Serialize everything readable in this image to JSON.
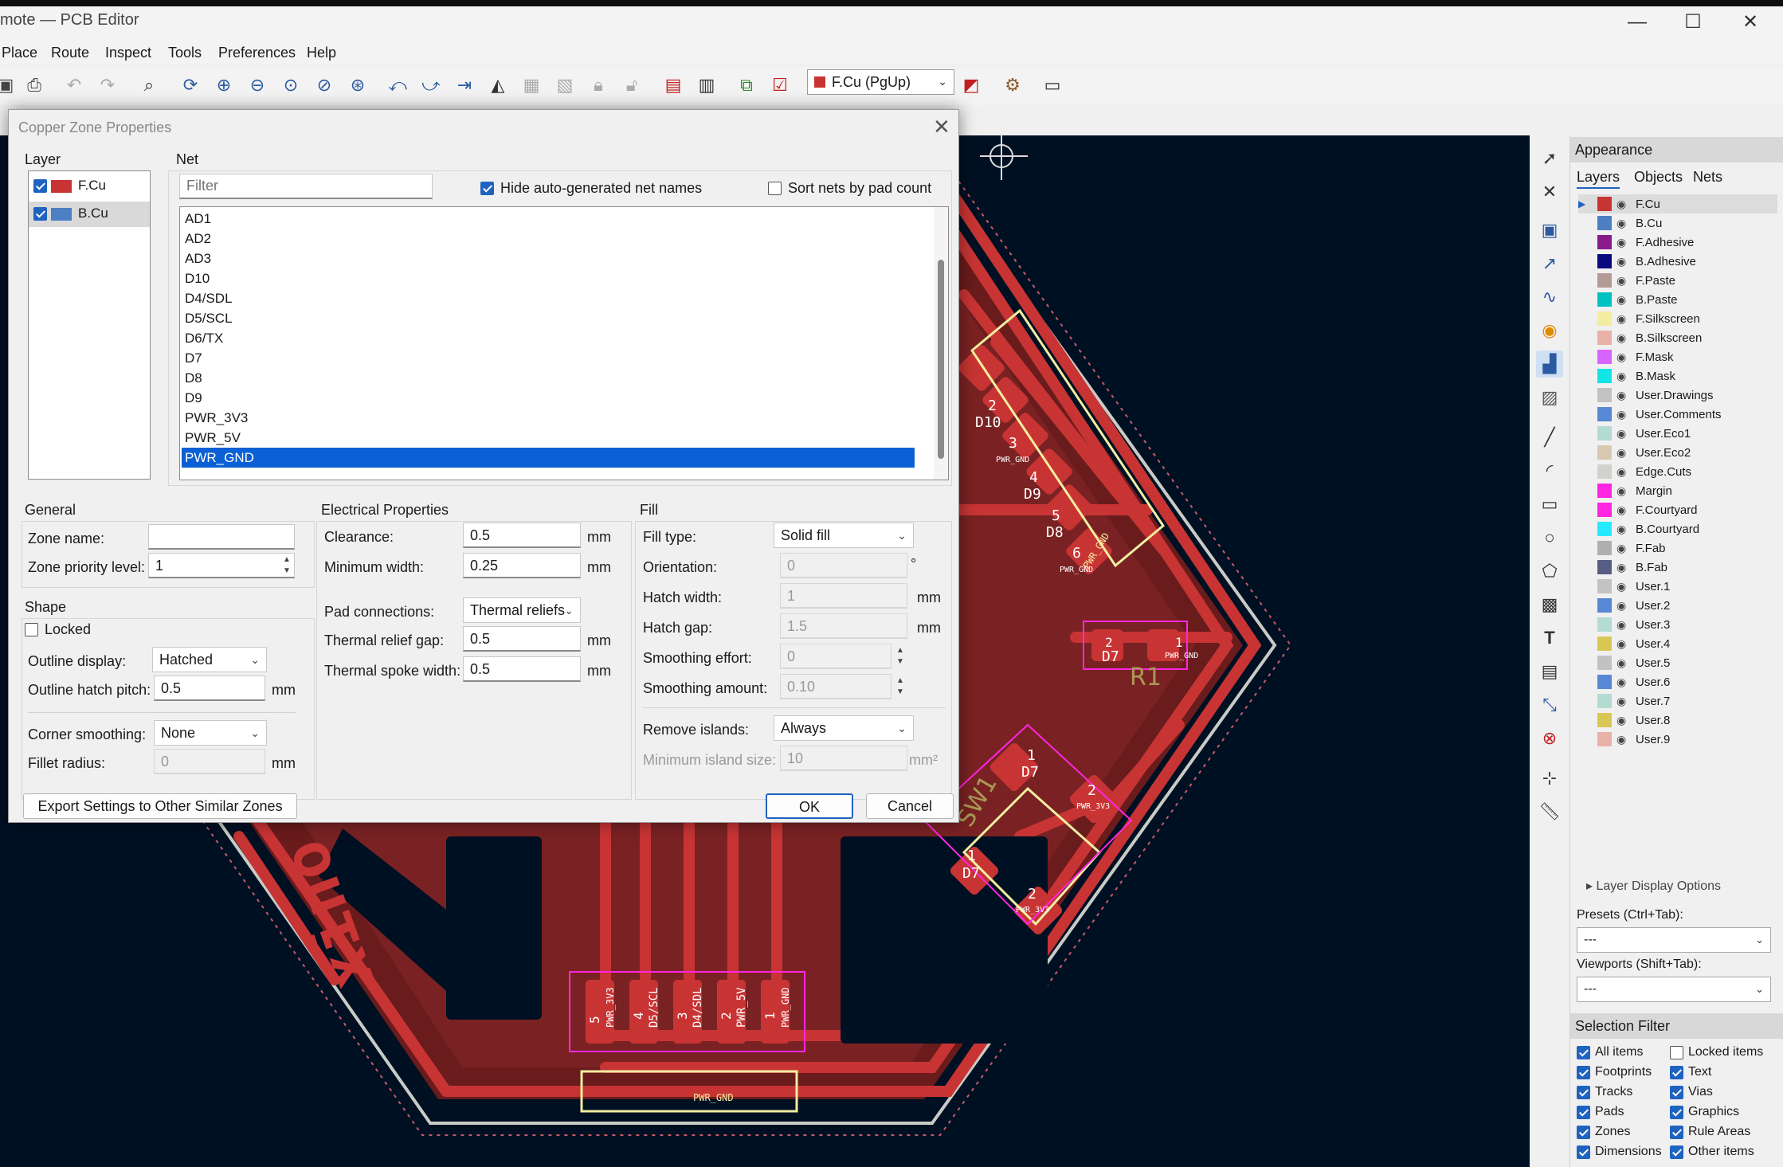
{
  "window": {
    "title": "mote — PCB Editor",
    "minimize": "—",
    "maximize": "☐",
    "close": "✕"
  },
  "menu": [
    "Place",
    "Route",
    "Inspect",
    "Tools",
    "Preferences",
    "Help"
  ],
  "toolbar": {
    "active_layer": "F.Cu (PgUp)",
    "layer_color": "#c83434"
  },
  "dialog": {
    "title": "Copper Zone Properties",
    "layer_label": "Layer",
    "layers": [
      {
        "name": "F.Cu",
        "color": "#c83434",
        "checked": true
      },
      {
        "name": "B.Cu",
        "color": "#4d7fc4",
        "checked": true
      }
    ],
    "net_label": "Net",
    "filter_placeholder": "Filter",
    "hide_auto_label": "Hide auto-generated net names",
    "sort_label": "Sort nets by pad count",
    "nets": [
      "AD1",
      "AD2",
      "AD3",
      "D10",
      "D4/SDL",
      "D5/SCL",
      "D6/TX",
      "D7",
      "D8",
      "D9",
      "PWR_3V3",
      "PWR_5V",
      "PWR_GND"
    ],
    "selected_net": "PWR_GND",
    "general": {
      "title": "General",
      "zone_name_label": "Zone name:",
      "zone_name": "",
      "priority_label": "Zone priority level:",
      "priority": "1"
    },
    "shape": {
      "title": "Shape",
      "locked_label": "Locked",
      "outline_display_label": "Outline display:",
      "outline_display": "Hatched",
      "hatch_pitch_label": "Outline hatch pitch:",
      "hatch_pitch": "0.5",
      "corner_label": "Corner smoothing:",
      "corner": "None",
      "fillet_label": "Fillet radius:",
      "fillet": "0",
      "unit": "mm"
    },
    "electrical": {
      "title": "Electrical Properties",
      "clearance_label": "Clearance:",
      "clearance": "0.5",
      "min_width_label": "Minimum width:",
      "min_width": "0.25",
      "pad_conn_label": "Pad connections:",
      "pad_conn": "Thermal reliefs",
      "relief_gap_label": "Thermal relief gap:",
      "relief_gap": "0.5",
      "spoke_label": "Thermal spoke width:",
      "spoke": "0.5",
      "unit": "mm"
    },
    "fill": {
      "title": "Fill",
      "type_label": "Fill type:",
      "type": "Solid fill",
      "orient_label": "Orientation:",
      "orient": "0",
      "orient_unit": "°",
      "hatch_w_label": "Hatch width:",
      "hatch_w": "1",
      "hatch_gap_label": "Hatch gap:",
      "hatch_gap": "1.5",
      "smooth_eff_label": "Smoothing effort:",
      "smooth_eff": "0",
      "smooth_amt_label": "Smoothing amount:",
      "smooth_amt": "0.10",
      "islands_label": "Remove islands:",
      "islands": "Always",
      "min_island_label": "Minimum island size:",
      "min_island": "10",
      "min_island_unit": "mm²",
      "unit": "mm"
    },
    "export_btn": "Export Settings to Other Similar Zones",
    "ok": "OK",
    "cancel": "Cancel"
  },
  "appearance": {
    "title": "Appearance",
    "tabs": [
      "Layers",
      "Objects",
      "Nets"
    ],
    "layers": [
      {
        "name": "F.Cu",
        "color": "#c83434"
      },
      {
        "name": "B.Cu",
        "color": "#4d7fc4"
      },
      {
        "name": "F.Adhesive",
        "color": "#8a1a8a"
      },
      {
        "name": "B.Adhesive",
        "color": "#0a0a80"
      },
      {
        "name": "F.Paste",
        "color": "#b49a94"
      },
      {
        "name": "B.Paste",
        "color": "#00c2c2"
      },
      {
        "name": "F.Silkscreen",
        "color": "#f2eda1"
      },
      {
        "name": "B.Silkscreen",
        "color": "#e8b2a7"
      },
      {
        "name": "F.Mask",
        "color": "#d864ff"
      },
      {
        "name": "B.Mask",
        "color": "#12e5e5"
      },
      {
        "name": "User.Drawings",
        "color": "#c2c2c2"
      },
      {
        "name": "User.Comments",
        "color": "#5988d4"
      },
      {
        "name": "User.Eco1",
        "color": "#b4dbd2"
      },
      {
        "name": "User.Eco2",
        "color": "#d8c8b0"
      },
      {
        "name": "Edge.Cuts",
        "color": "#d0d2cd"
      },
      {
        "name": "Margin",
        "color": "#ff26e2"
      },
      {
        "name": "F.Courtyard",
        "color": "#ff26e2"
      },
      {
        "name": "B.Courtyard",
        "color": "#26e9ff"
      },
      {
        "name": "F.Fab",
        "color": "#afafaf"
      },
      {
        "name": "B.Fab",
        "color": "#585d84"
      },
      {
        "name": "User.1",
        "color": "#c2c2c2"
      },
      {
        "name": "User.2",
        "color": "#5988d4"
      },
      {
        "name": "User.3",
        "color": "#b4dbd2"
      },
      {
        "name": "User.4",
        "color": "#d8c853"
      },
      {
        "name": "User.5",
        "color": "#c2c2c2"
      },
      {
        "name": "User.6",
        "color": "#5988d4"
      },
      {
        "name": "User.7",
        "color": "#b4dbd2"
      },
      {
        "name": "User.8",
        "color": "#d8c853"
      },
      {
        "name": "User.9",
        "color": "#e8b2a7"
      }
    ],
    "layer_display_options": "Layer Display Options",
    "presets_label": "Presets (Ctrl+Tab):",
    "presets_value": "---",
    "viewports_label": "Viewports (Shift+Tab):",
    "viewports_value": "---"
  },
  "selection_filter": {
    "title": "Selection Filter",
    "items": [
      {
        "label": "All items",
        "checked": true
      },
      {
        "label": "Locked items",
        "checked": false
      },
      {
        "label": "Footprints",
        "checked": true
      },
      {
        "label": "Text",
        "checked": true
      },
      {
        "label": "Tracks",
        "checked": true
      },
      {
        "label": "Vias",
        "checked": true
      },
      {
        "label": "Pads",
        "checked": true
      },
      {
        "label": "Graphics",
        "checked": true
      },
      {
        "label": "Zones",
        "checked": true
      },
      {
        "label": "Rule Areas",
        "checked": true
      },
      {
        "label": "Dimensions",
        "checked": true
      },
      {
        "label": "Other items",
        "checked": true
      }
    ]
  },
  "board": {
    "ref_r1": "R1",
    "ref_sw1": "SW1",
    "logo_text": "xino",
    "pads": [
      "2",
      "D7",
      "1",
      "PWR_GND",
      "1",
      "D7",
      "2",
      "PWR_3V3",
      "1",
      "D7",
      "2",
      "PWR_3V3",
      "2",
      "D10",
      "3",
      "PWR_GND",
      "4",
      "D9",
      "5",
      "D8",
      "6",
      "PWR_GND",
      "5",
      "PWR_3V3",
      "4",
      "D5/SCL",
      "3",
      "D4/SDL",
      "2",
      "PWR_5V",
      "1",
      "PWR_GND",
      "PWR_GND",
      "PWR_GND"
    ]
  }
}
